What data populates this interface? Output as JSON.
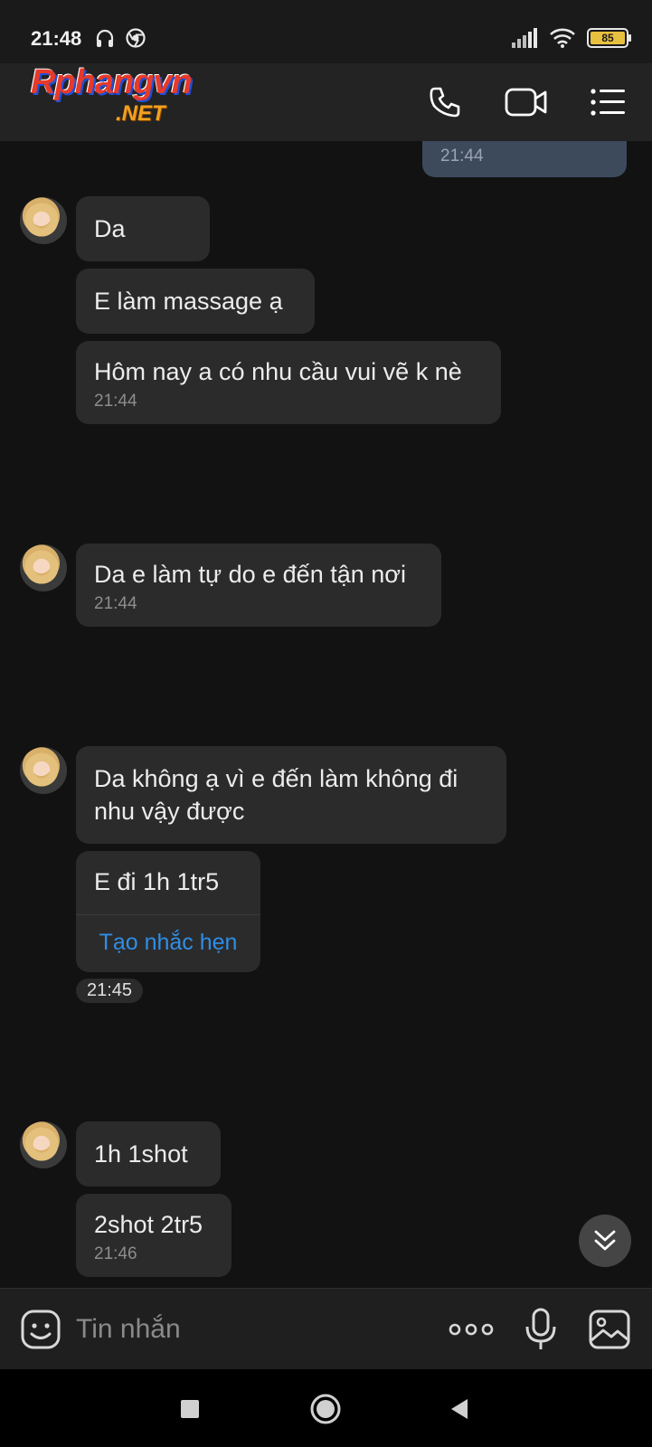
{
  "status_bar": {
    "time": "21:48",
    "battery": "85"
  },
  "header": {
    "logo_main": "Rphangvn",
    "logo_suffix": ".NET"
  },
  "chat": {
    "partial_outgoing_time": "21:44",
    "group1": {
      "msg1": "Da",
      "msg2": "E làm massage ạ",
      "msg3": "Hôm nay a có nhu cầu vui vẽ k nè",
      "time": "21:44"
    },
    "group2": {
      "msg1": "Da e làm tự do e đến tận nơi",
      "time": "21:44"
    },
    "group3": {
      "msg1_line1": "Da không ạ vì e đến làm không đi",
      "msg1_line2": "nhu vậy được",
      "msg2": "E đi 1h 1tr5",
      "reminder_link": "Tạo nhắc hẹn",
      "time": "21:45"
    },
    "group4": {
      "msg1": "1h 1shot",
      "msg2": "2shot 2tr5",
      "time": "21:46"
    }
  },
  "composer": {
    "placeholder": "Tin nhắn"
  },
  "colors": {
    "background": "#121212",
    "bubble": "#2b2b2b",
    "link": "#2f8ee6",
    "outgoing_bubble": "#3d4a5c"
  }
}
